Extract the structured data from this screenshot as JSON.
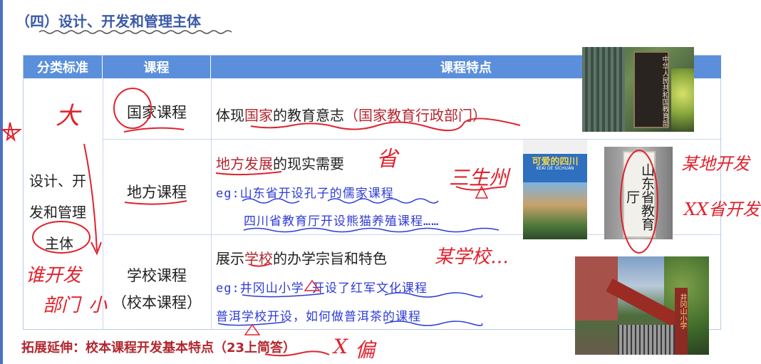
{
  "title": "（四）设计、开发和管理主体",
  "table": {
    "headers": [
      "分类标准",
      "课程",
      "课程特点"
    ],
    "category": "设计、开发和管理主体",
    "category_lines": [
      "设计、开",
      "发和管理",
      "主体"
    ],
    "rows": [
      {
        "course": "国家课程",
        "feature_plain_1": "体现",
        "feature_red_1": "国家",
        "feature_plain_2": "的教育意志",
        "feature_red_2": "（国家教育行政部门）"
      },
      {
        "course": "地方课程",
        "feature_red_1": "地方发展",
        "feature_plain_1": "的现实需要",
        "example_1": "eg:山东省开设孔子的儒家课程",
        "example_2": "四川省教育厅开设熊猫养殖课程……"
      },
      {
        "course_line_1": "学校课程",
        "course_line_2": "（校本课程）",
        "feature_plain_1": "展示",
        "feature_red_1": "学校",
        "feature_plain_2": "的办学宗旨和特色",
        "example_1": "eg:井冈山小学 开设了红军文化课程",
        "example_2": "普洱学校开设，如何做普洱茶的课程"
      }
    ]
  },
  "extension": "拓展延伸：校本课程开发基本特点（23上简答）",
  "images": {
    "ministry_sign": "中华人民共和国教育部",
    "book_title": "可爱的四川",
    "book_subtitle": "KEAI DE SICHUAN",
    "shandong_sign": "山东省教育厅",
    "school_gate": "井冈山小学"
  },
  "handwriting": {
    "da": "大",
    "sheng": "省",
    "sanshengzhou": "三生州",
    "mou_di": "某地开发",
    "xx_sheng": "XX省开发",
    "mou_xiao": "某学校…",
    "shei_kaifa": "谁开发",
    "bumen": "部门",
    "xiao": "小",
    "pian": "偏",
    "x_mark": "X"
  },
  "colors": {
    "header_bg": "#5b8fdb",
    "title": "#3b5aa8",
    "red_text": "#b3262e",
    "example_blue": "#2d3bd6",
    "ink_red": "#e0222d"
  }
}
